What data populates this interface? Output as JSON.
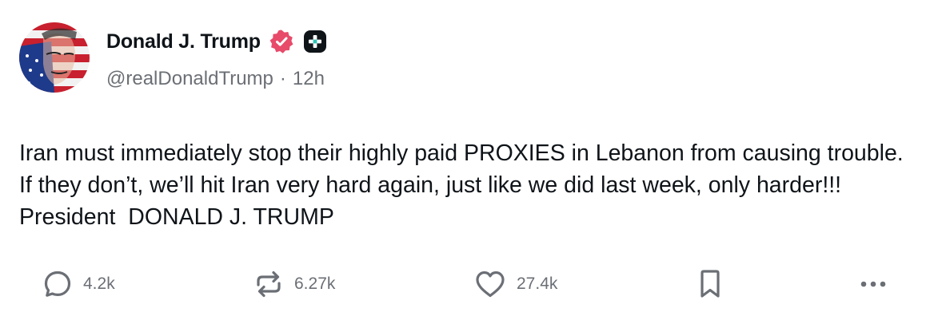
{
  "author": {
    "display_name": "Donald J. Trump",
    "handle": "@realDonaldTrump",
    "separator": "·",
    "time_ago": "12h",
    "verified_color": "#e84a6a"
  },
  "post": {
    "text": "Iran must immediately stop their highly paid PROXIES in Lebanon from causing trouble. If they don’t, we’ll hit Iran very hard again, just like we did last week, only harder!!! President  DONALD J. TRUMP"
  },
  "actions": {
    "replies": "4.2k",
    "reposts": "6.27k",
    "likes": "27.4k"
  },
  "icons": {
    "verified": "verified-badge-icon",
    "plus": "plus-badge-icon",
    "reply": "comment-bubble-icon",
    "repost": "repost-arrows-icon",
    "like": "heart-icon",
    "bookmark": "bookmark-icon",
    "more": "more-dots-icon"
  }
}
